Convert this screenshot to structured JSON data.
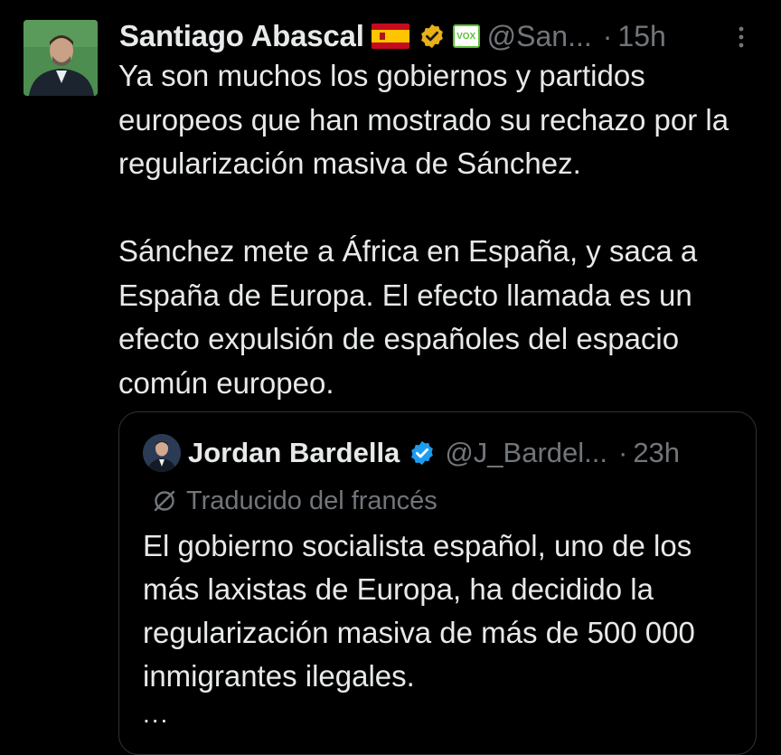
{
  "tweet": {
    "author_name": "Santiago Abascal",
    "badges": [
      "spain-flag-icon",
      "gold-verified-icon",
      "vox-badge"
    ],
    "vox_label": "VOX",
    "handle": "@San...",
    "separator": "·",
    "time": "15h",
    "text": "Ya son muchos los gobiernos y partidos europeos que han mostrado su rechazo por la regularización masiva de Sánchez.\n\nSánchez mete a África en España, y saca a España de Europa. El efecto llamada es un efecto expulsión de españoles del espacio común europeo.",
    "more_icon": "more-options-icon"
  },
  "quote": {
    "author_name": "Jordan Bardella",
    "handle": "@J_Bardel...",
    "separator": "·",
    "time": "23h",
    "translated_label": "Traducido del francés",
    "text": "El gobierno socialista español, uno de los más laxistas de Europa, ha decidido la regularización masiva de más de 500 000 inmigrantes ilegales.",
    "ellipsis": "..."
  },
  "colors": {
    "background": "#000000",
    "primary_text": "#e7e9ea",
    "secondary_text": "#71767b",
    "border": "#2f3336",
    "gold_badge": "#e8b118",
    "blue_badge": "#1d9bf0"
  }
}
